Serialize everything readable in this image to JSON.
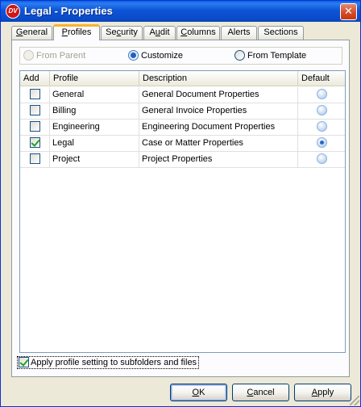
{
  "window": {
    "title": "Legal - Properties",
    "app_icon_text": "DV",
    "close_glyph": "✕"
  },
  "tabs": [
    {
      "label_pre": "",
      "label_key": "G",
      "label_post": "eneral"
    },
    {
      "label_pre": "",
      "label_key": "P",
      "label_post": "rofiles"
    },
    {
      "label_pre": "Se",
      "label_key": "c",
      "label_post": "urity"
    },
    {
      "label_pre": "A",
      "label_key": "u",
      "label_post": "dit"
    },
    {
      "label_pre": "",
      "label_key": "C",
      "label_post": "olumns"
    },
    {
      "label_pre": "Alerts",
      "label_key": "",
      "label_post": ""
    },
    {
      "label_pre": "Sections",
      "label_key": "",
      "label_post": ""
    }
  ],
  "source_options": [
    {
      "label": "From Parent",
      "enabled": false,
      "selected": false
    },
    {
      "label": "Customize",
      "enabled": true,
      "selected": true
    },
    {
      "label": "From Template",
      "enabled": true,
      "selected": false
    }
  ],
  "grid": {
    "columns": [
      "Add",
      "Profile",
      "Description",
      "Default"
    ],
    "rows": [
      {
        "added": false,
        "profile": "General",
        "description": "General Document Properties",
        "default": false
      },
      {
        "added": false,
        "profile": "Billing",
        "description": "General Invoice Properties",
        "default": false
      },
      {
        "added": false,
        "profile": "Engineering",
        "description": "Engineering Document Properties",
        "default": false
      },
      {
        "added": true,
        "profile": "Legal",
        "description": "Case or Matter Properties",
        "default": true
      },
      {
        "added": false,
        "profile": "Project",
        "description": "Project Properties",
        "default": false
      }
    ]
  },
  "apply_subfolders": {
    "label": "Apply profile setting to subfolders and files",
    "checked": true
  },
  "buttons": {
    "ok": {
      "pre": "",
      "key": "O",
      "post": "K"
    },
    "cancel": {
      "pre": "",
      "key": "C",
      "post": "ancel"
    },
    "apply": {
      "pre": "",
      "key": "A",
      "post": "pply"
    }
  }
}
